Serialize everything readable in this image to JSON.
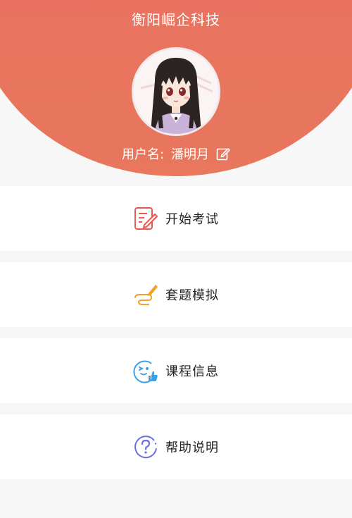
{
  "app": {
    "title": "衡阳崛企科技"
  },
  "user": {
    "username_label": "用户名:",
    "username": "潘明月"
  },
  "menu": [
    {
      "label": "开始考试",
      "icon": "exam-edit-icon",
      "color": "#e85a52"
    },
    {
      "label": "套题模拟",
      "icon": "pen-signature-icon",
      "color": "#f2a02a"
    },
    {
      "label": "课程信息",
      "icon": "thumbs-up-face-icon",
      "color": "#3aa0e8"
    },
    {
      "label": "帮助说明",
      "icon": "help-question-icon",
      "color": "#6a6ee6"
    }
  ],
  "colors": {
    "header_gradient_top": "#ec6a66",
    "header_gradient_bottom": "#e8775d",
    "background": "#f7f7f7"
  }
}
